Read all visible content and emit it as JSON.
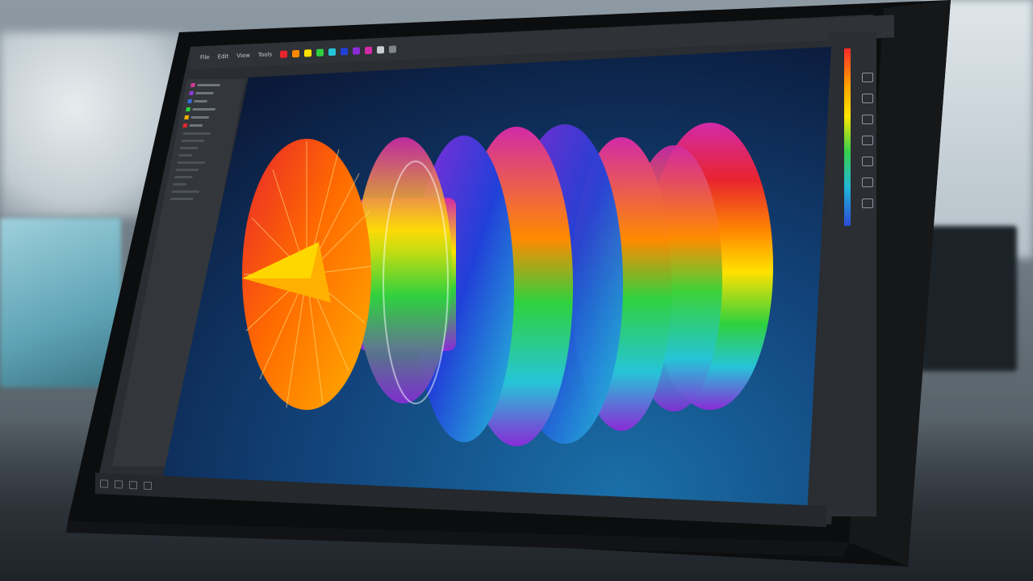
{
  "scene": {
    "type": "photo",
    "subject": "monitor-displaying-cfd-simulation",
    "palette": {
      "red": "#e8242e",
      "orange": "#ff8a00",
      "yellow": "#ffe100",
      "green": "#2fd13e",
      "cyan": "#26c4d8",
      "blue": "#2140d8",
      "purple": "#8a2bd6",
      "magenta": "#d22aa8",
      "viewport_top": "#07122a",
      "viewport_bottom": "#1a6fa8",
      "ui_dark": "#2a2d31"
    }
  },
  "app": {
    "menu": [
      "File",
      "Edit",
      "View",
      "Tools"
    ],
    "toolbar_icons": [
      "select-icon",
      "rotate-icon",
      "pan-icon",
      "zoom-icon",
      "mesh-icon",
      "contour-icon",
      "vector-icon",
      "probe-icon",
      "clip-icon",
      "iso-icon"
    ],
    "left_panel_rows": [
      {
        "color": "#d23a9c"
      },
      {
        "color": "#8d3ad2"
      },
      {
        "color": "#3a6ad2"
      },
      {
        "color": "#2fd13e"
      },
      {
        "color": "#ffb000"
      },
      {
        "color": "#e8242e"
      }
    ],
    "right_panel_icons": [
      "view-icon",
      "layers-icon",
      "light-icon",
      "camera-icon",
      "grid-icon",
      "axis-icon",
      "export-icon"
    ],
    "status_icons": [
      "home-icon",
      "fit-icon",
      "wire-icon",
      "solid-icon"
    ]
  }
}
